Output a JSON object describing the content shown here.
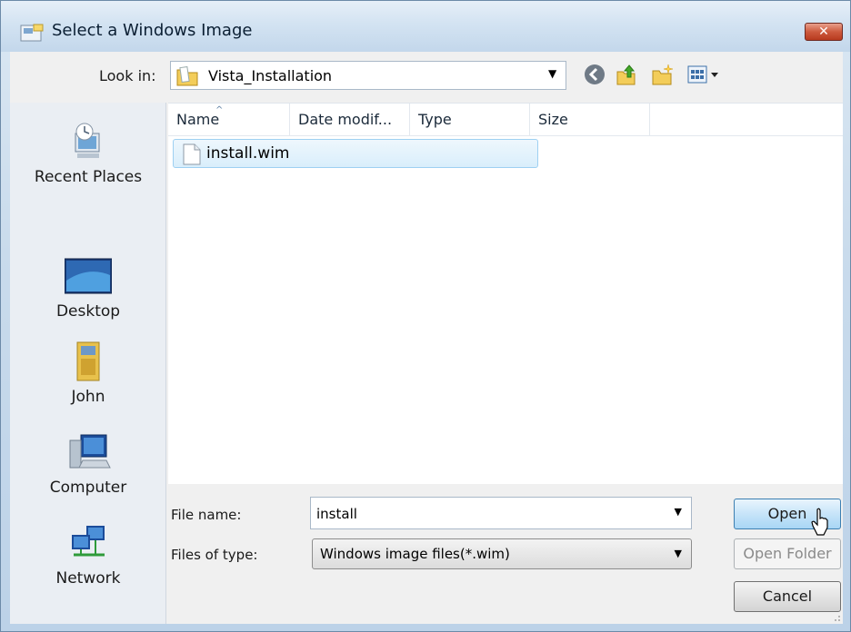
{
  "window": {
    "title": "Select a Windows Image",
    "close_label": "✕"
  },
  "lookin": {
    "label": "Look in:",
    "value": "Vista_Installation"
  },
  "places": [
    {
      "label": "Recent Places",
      "icon": "recent-places-icon"
    },
    {
      "label": "Desktop",
      "icon": "desktop-icon"
    },
    {
      "label": "John",
      "icon": "user-folder-icon"
    },
    {
      "label": "Computer",
      "icon": "computer-icon"
    },
    {
      "label": "Network",
      "icon": "network-icon"
    }
  ],
  "filelist": {
    "columns": [
      "Name",
      "Date modif...",
      "Type",
      "Size"
    ],
    "sort_indicator": "^",
    "files": [
      {
        "name": "install.wim"
      }
    ]
  },
  "form": {
    "filename_label": "File name:",
    "filename_value": "install",
    "filetype_label": "Files of type:",
    "filetype_value": "Windows image files(*.wim)"
  },
  "buttons": {
    "open": "Open",
    "open_folder": "Open Folder",
    "cancel": "Cancel"
  },
  "colors": {
    "accent": "#3c7fb1",
    "selection": "#d9eefb",
    "close": "#cd5a3e"
  }
}
